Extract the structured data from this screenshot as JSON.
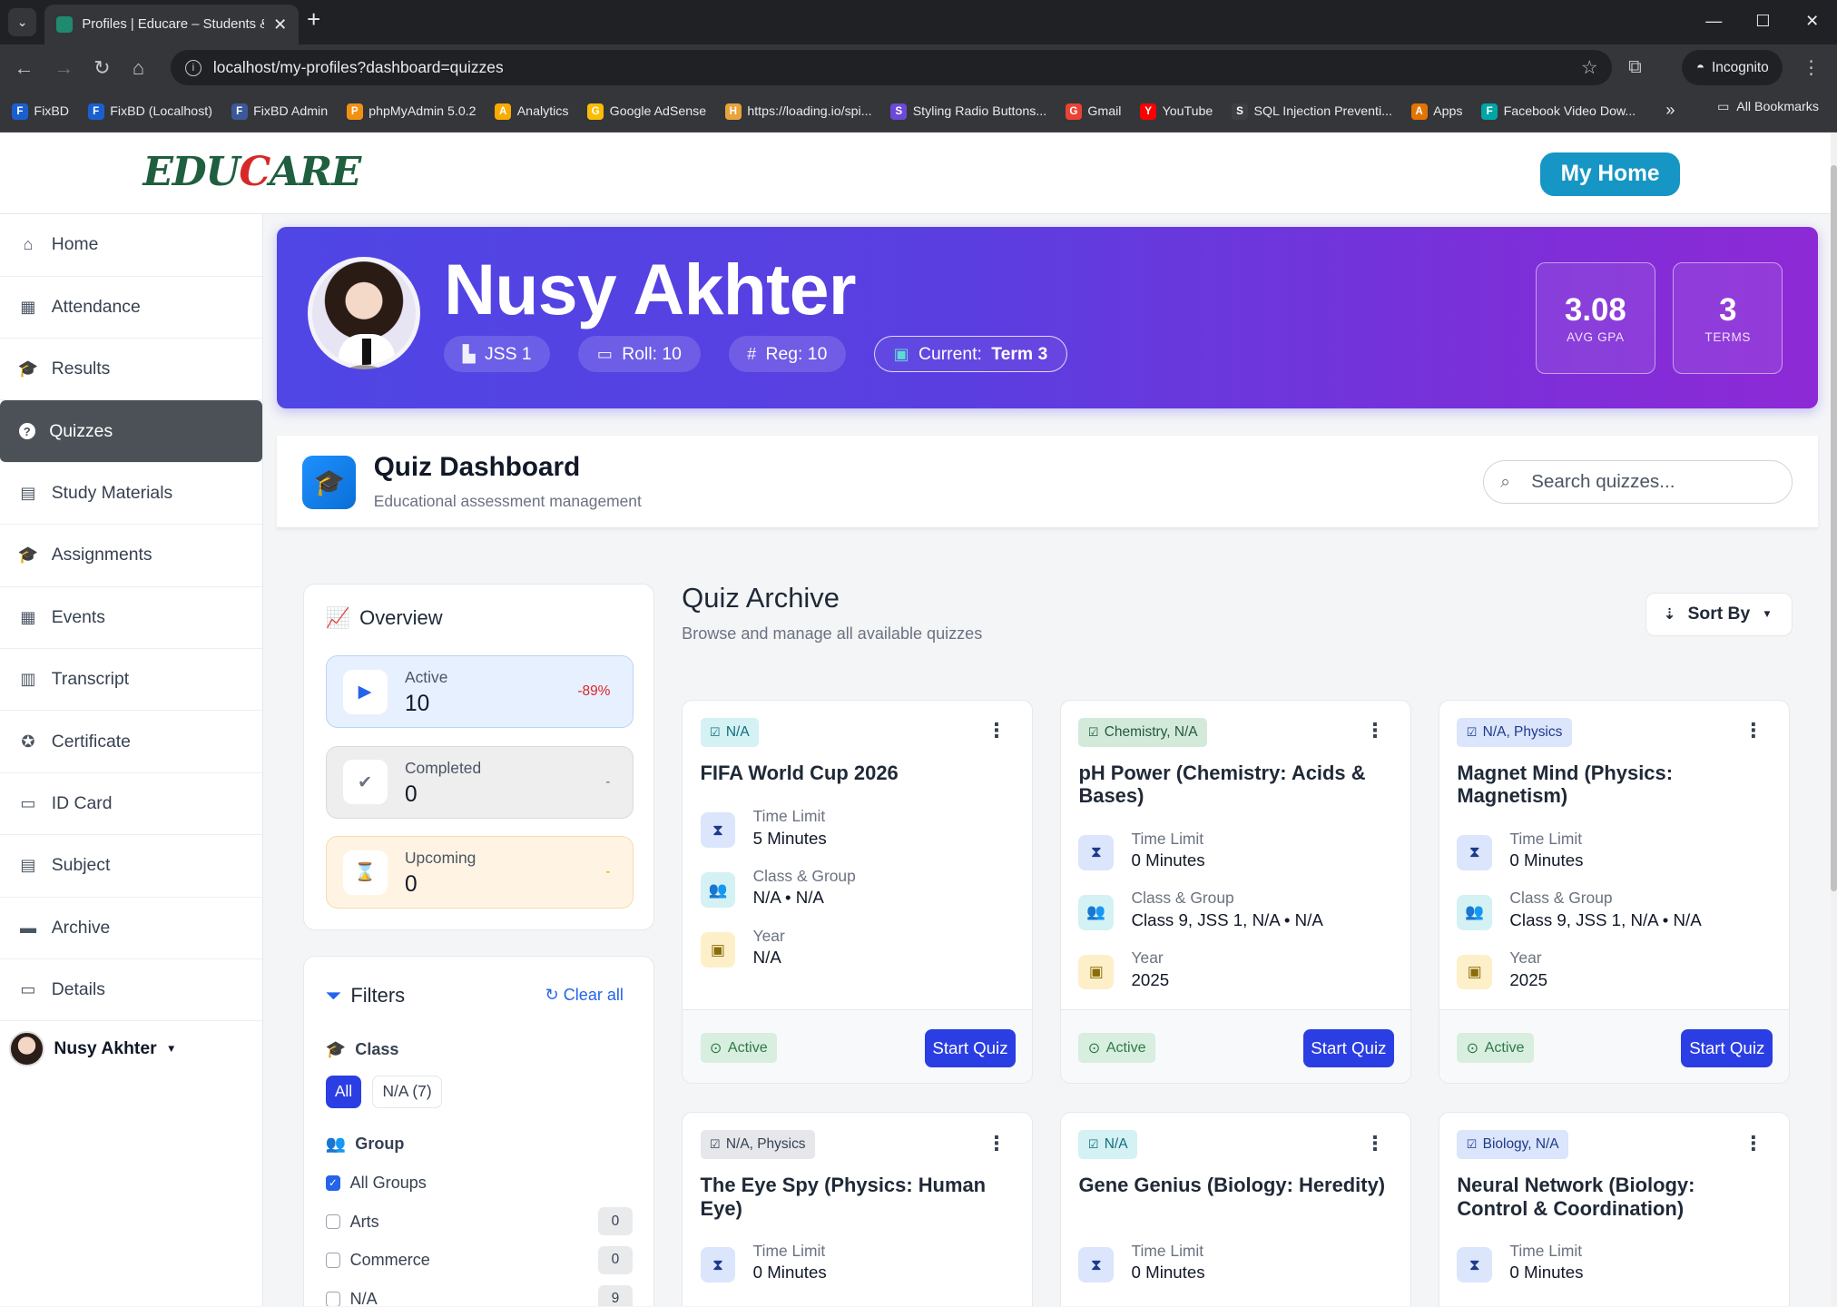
{
  "browser": {
    "tab_title": "Profiles | Educare – Students & Re",
    "url": "localhost/my-profiles?dashboard=quizzes",
    "incognito_label": "Incognito",
    "bookmarks": [
      "FixBD",
      "FixBD (Localhost)",
      "FixBD Admin",
      "phpMyAdmin 5.0.2",
      "Analytics",
      "Google AdSense",
      "https://loading.io/spi...",
      "Styling Radio Buttons...",
      "Gmail",
      "YouTube",
      "SQL Injection Preventi...",
      "Apps",
      "Facebook Video Dow..."
    ],
    "bookmark_colors": [
      "#1a5fd0",
      "#1a5fd0",
      "#3b5998",
      "#f29111",
      "#f9ab00",
      "#fbbc04",
      "#e8a33c",
      "#6c4ad8",
      "#ea4335",
      "#ff0000",
      "#3c4043",
      "#e37400",
      "#00a6a6"
    ],
    "all_bookmarks": "All Bookmarks"
  },
  "header": {
    "logo_main": "EDU",
    "logo_accent": "C",
    "logo_tail": "ARE",
    "my_home": "My Home"
  },
  "sidebar": {
    "items": [
      {
        "label": "Home",
        "icon": "house-icon",
        "glyph": "⌂"
      },
      {
        "label": "Attendance",
        "icon": "calendar-check-icon",
        "glyph": "▦"
      },
      {
        "label": "Results",
        "icon": "graduation-cap-icon",
        "glyph": "🎓"
      },
      {
        "label": "Quizzes",
        "icon": "question-circle-icon",
        "glyph": "?"
      },
      {
        "label": "Study Materials",
        "icon": "book-icon",
        "glyph": "▤"
      },
      {
        "label": "Assignments",
        "icon": "graduation-cap-icon",
        "glyph": "🎓"
      },
      {
        "label": "Events",
        "icon": "calendar-icon",
        "glyph": "▦"
      },
      {
        "label": "Transcript",
        "icon": "file-icon",
        "glyph": "▥"
      },
      {
        "label": "Certificate",
        "icon": "award-icon",
        "glyph": "✪"
      },
      {
        "label": "ID Card",
        "icon": "id-card-icon",
        "glyph": "▭"
      },
      {
        "label": "Subject",
        "icon": "book-icon",
        "glyph": "▤"
      },
      {
        "label": "Archive",
        "icon": "archive-icon",
        "glyph": "▬"
      },
      {
        "label": "Details",
        "icon": "id-card-icon",
        "glyph": "▭"
      }
    ],
    "active_index": 3,
    "user_name": "Nusy Akhter"
  },
  "profile": {
    "name": "Nusy Akhter",
    "class": "JSS 1",
    "roll": "Roll: 10",
    "reg": "Reg: 10",
    "current_prefix": "Current:",
    "current_term": "Term 3",
    "avg_gpa": "3.08",
    "avg_gpa_label": "AVG GPA",
    "terms": "3",
    "terms_label": "TERMS"
  },
  "dashboard": {
    "title": "Quiz Dashboard",
    "subtitle": "Educational assessment management",
    "search_placeholder": "Search quizzes..."
  },
  "overview": {
    "title": "Overview",
    "cards": [
      {
        "label": "Active",
        "value": "10",
        "delta": "-89%",
        "bg": "#e7f0ff",
        "border": "#bcd4f7",
        "icon_color": "#2563eb",
        "delta_color": "#dc2626",
        "glyph": "▶"
      },
      {
        "label": "Completed",
        "value": "0",
        "delta": "-",
        "bg": "#eeeeef",
        "border": "#d9dadd",
        "icon_color": "#6b7280",
        "delta_color": "#6b7280",
        "glyph": "✔"
      },
      {
        "label": "Upcoming",
        "value": "0",
        "delta": "-",
        "bg": "#fff4e3",
        "border": "#f5dcae",
        "icon_color": "#f0a500",
        "delta_color": "#f0a500",
        "glyph": "⌛"
      }
    ]
  },
  "filters": {
    "title": "Filters",
    "clear_all": "Clear all",
    "class_label": "Class",
    "class_all": "All",
    "class_na": "N/A (7)",
    "group_label": "Group",
    "groups": [
      {
        "label": "All Groups",
        "checked": true,
        "count": ""
      },
      {
        "label": "Arts",
        "checked": false,
        "count": "0"
      },
      {
        "label": "Commerce",
        "checked": false,
        "count": "0"
      },
      {
        "label": "N/A",
        "checked": false,
        "count": "9"
      }
    ]
  },
  "archive": {
    "title": "Quiz Archive",
    "subtitle": "Browse and manage all available quizzes",
    "sort_by": "Sort By",
    "meta_labels": {
      "time": "Time Limit",
      "class": "Class & Group",
      "year": "Year"
    },
    "status_label": "Active",
    "start_label": "Start Quiz",
    "quizzes": [
      {
        "tag": "N/A",
        "tag_bg": "#d4f1f4",
        "tag_color": "#0f6e7a",
        "title": "FIFA World Cup 2026",
        "time": "5 Minutes",
        "class_group": "N/A • N/A",
        "year": "N/A"
      },
      {
        "tag": "Chemistry, N/A",
        "tag_bg": "#d3eadb",
        "tag_color": "#24593a",
        "title": "pH Power (Chemistry: Acids & Bases)",
        "time": "0 Minutes",
        "class_group": "Class 9, JSS 1, N/A • N/A",
        "year": "2025"
      },
      {
        "tag": "N/A, Physics",
        "tag_bg": "#dbe5fb",
        "tag_color": "#1e3a8a",
        "title": "Magnet Mind (Physics: Magnetism)",
        "time": "0 Minutes",
        "class_group": "Class 9, JSS 1, N/A • N/A",
        "year": "2025"
      },
      {
        "tag": "N/A, Physics",
        "tag_bg": "#e5e7eb",
        "tag_color": "#374151",
        "title": "The Eye Spy (Physics: Human Eye)",
        "time": "0 Minutes",
        "class_group": "",
        "year": ""
      },
      {
        "tag": "N/A",
        "tag_bg": "#d4f1f4",
        "tag_color": "#0f6e7a",
        "title": "Gene Genius (Biology: Heredity)",
        "time": "0 Minutes",
        "class_group": "",
        "year": ""
      },
      {
        "tag": "Biology, N/A",
        "tag_bg": "#dbe5fb",
        "tag_color": "#1e3a8a",
        "title": "Neural Network (Biology: Control & Coordination)",
        "time": "0 Minutes",
        "class_group": "",
        "year": ""
      }
    ]
  }
}
